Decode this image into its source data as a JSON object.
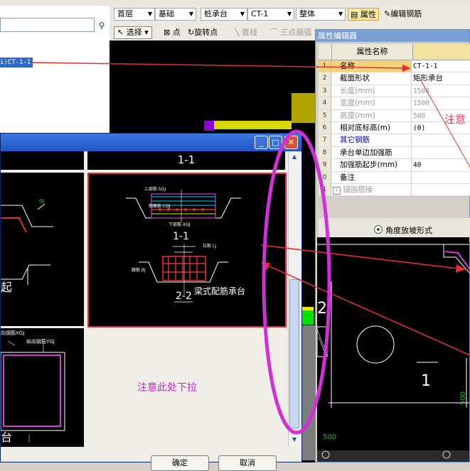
{
  "toolbar": {
    "floor": "首层",
    "category": "基础",
    "component_type": "桩承台",
    "component": "CT-1",
    "scope": "整体",
    "properties_btn": "属性",
    "edit_rebar_btn": "编辑钢筋"
  },
  "toolbar2": {
    "select": "选择",
    "point": "点",
    "rotate_point": "旋转点",
    "line": "直线",
    "arc": "三点画弧"
  },
  "tree": {
    "selected": "i)CT-1-1"
  },
  "property_editor": {
    "title": "属性编辑器",
    "header_name": "属性名称",
    "rows": [
      {
        "num": "1",
        "name": "名称",
        "value": "CT-1-1"
      },
      {
        "num": "2",
        "name": "截面形状",
        "value": "矩形承台"
      },
      {
        "num": "3",
        "name": "长度(mm)",
        "value": "1500"
      },
      {
        "num": "4",
        "name": "宽度(mm)",
        "value": "1500"
      },
      {
        "num": "5",
        "name": "高度(mm)",
        "value": "500"
      },
      {
        "num": "6",
        "name": "相对底标高(m)",
        "value": "(0)"
      },
      {
        "num": "7",
        "name": "其它钢筋",
        "value": ""
      },
      {
        "num": "8",
        "name": "承台单边加强筋",
        "value": ""
      },
      {
        "num": "9",
        "name": "加强筋起步(mm)",
        "value": "40"
      },
      {
        "num": "0",
        "name": "备注",
        "value": ""
      },
      {
        "num": "1",
        "name": "锚固搭接",
        "value": ""
      }
    ],
    "angle_option": "角度放坡形式",
    "canvas_labels": {
      "num2": "2",
      "num1": "1",
      "dim500": "500",
      "dim500b": "500"
    },
    "note": "注意"
  },
  "dialog": {
    "header_left_text": "",
    "header_section": "1-1",
    "left_text_qi": "起",
    "left_text_tai": "台",
    "left_label_rebar": "向钢筋XGJ",
    "left_label_rebar2": "纵向钢筋YGJ",
    "sec_title_2": "1-1",
    "sec_title_3": "2-2",
    "cap_label": "梁式配筋承台",
    "cad_small": {
      "top": "上部筋 SGJ",
      "side": "侧面筋 CGJ",
      "bottom": "下部筋 XGJ",
      "stirrup": "拉筋 LJ",
      "waist": "腰筋 BJ"
    },
    "note": "注意此处下拉",
    "ok": "确定",
    "cancel": "取消"
  }
}
